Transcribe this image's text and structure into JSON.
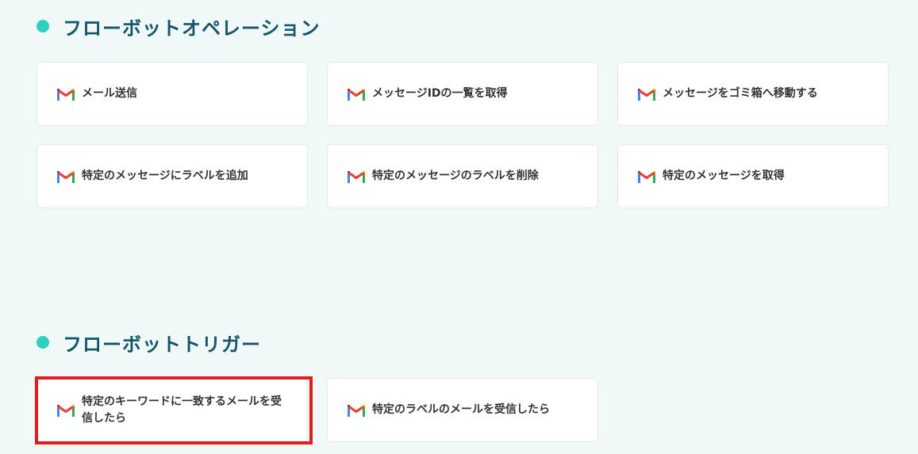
{
  "operations": {
    "title": "フローボットオペレーション",
    "items": [
      {
        "label": "メール送信"
      },
      {
        "label": "メッセージIDの一覧を取得"
      },
      {
        "label": "メッセージをゴミ箱へ移動する"
      },
      {
        "label": "特定のメッセージにラベルを追加"
      },
      {
        "label": "特定のメッセージのラベルを削除"
      },
      {
        "label": "特定のメッセージを取得"
      }
    ]
  },
  "triggers": {
    "title": "フローボットトリガー",
    "items": [
      {
        "label": "特定のキーワードに一致するメールを受信したら"
      },
      {
        "label": "特定のラベルのメールを受信したら"
      }
    ]
  },
  "colors": {
    "accent_dot": "#2fd0c0",
    "title": "#13566b",
    "highlight": "#e21c1c"
  },
  "icon": "gmail-icon"
}
